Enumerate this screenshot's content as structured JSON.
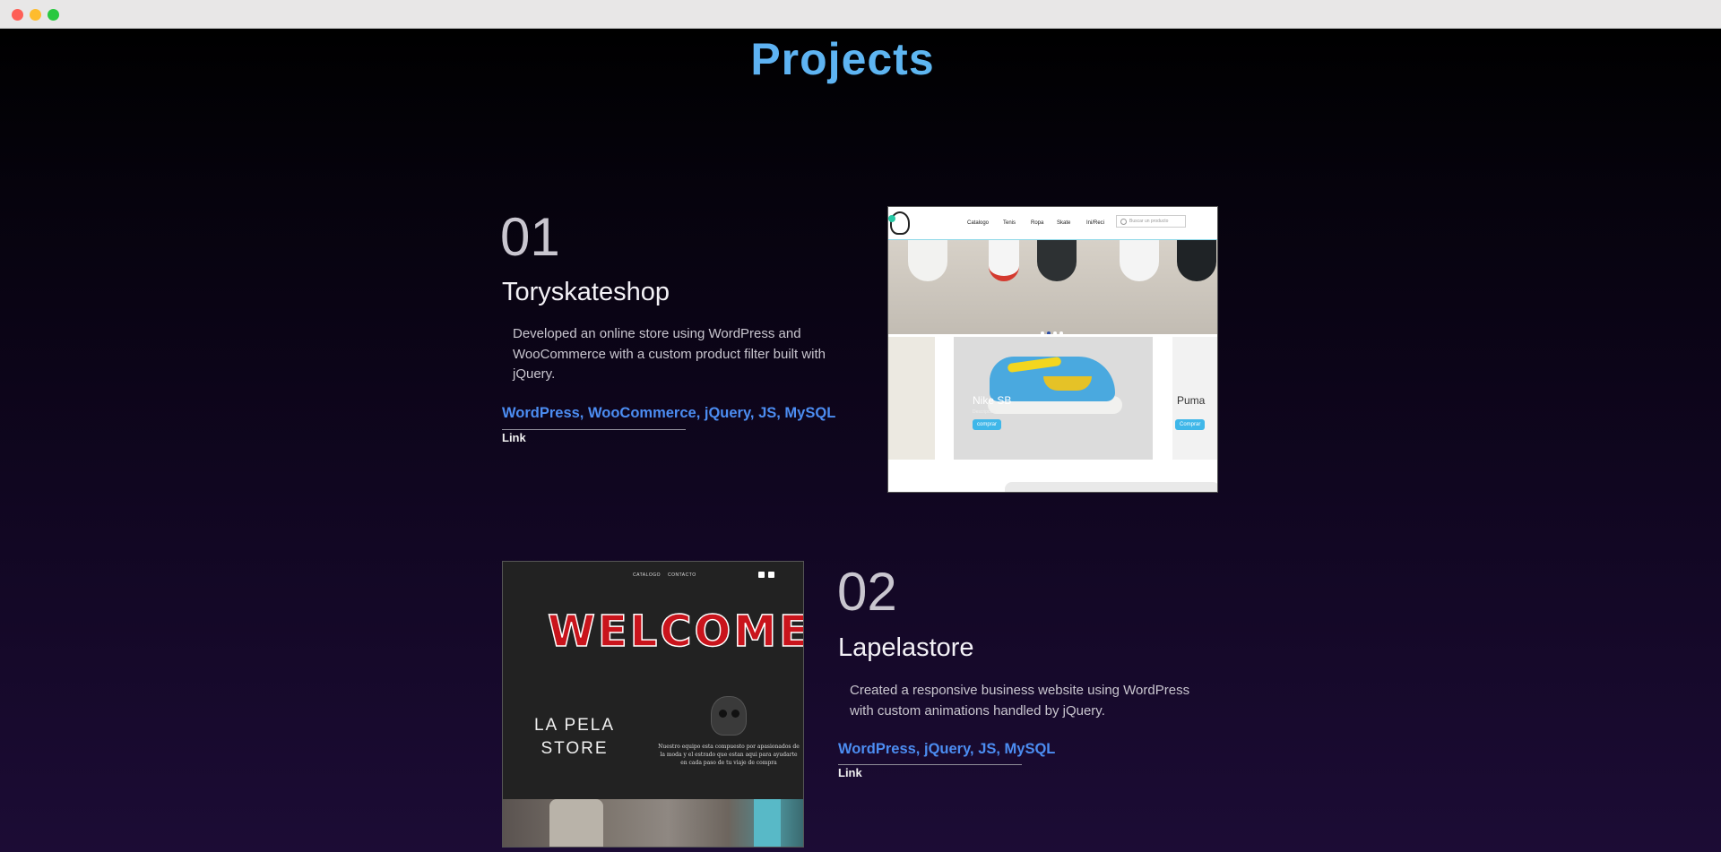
{
  "window": {
    "controls": [
      "close",
      "minimize",
      "maximize"
    ]
  },
  "section": {
    "title": "Projects"
  },
  "projects": [
    {
      "number": "01",
      "name": "Toryskateshop",
      "description": "Developed an online store using WordPress and WooCommerce with a custom product filter built with jQuery.",
      "tags": "WordPress, WooCommerce, jQuery, JS, MySQL",
      "link_label": "Link",
      "preview": {
        "nav": [
          "Catalogo",
          "Tenis",
          "Ropa",
          "Skate",
          "Ini/Reci"
        ],
        "search_placeholder": "Buscar un producto",
        "card_labels": [
          "Nike SB",
          "Puma"
        ],
        "buy_labels": [
          "comprar",
          "Comprar"
        ],
        "small_text": "Descripcion"
      }
    },
    {
      "number": "02",
      "name": "Lapelastore",
      "description": "Created a responsive business website using WordPress with custom animations handled by jQuery.",
      "tags": "WordPress, jQuery, JS, MySQL",
      "link_label": "Link",
      "preview": {
        "nav": [
          "CATALOGO",
          "CONTACTO"
        ],
        "welcome": "WELCOME",
        "store": "LA PELA STORE",
        "blurb": "Nuestro equipo esta compuesto por apasionados de la moda y el estrado que estan aqui para ayudarte en cada paso de tu viaje de compra"
      }
    }
  ],
  "colors": {
    "accent": "#4c8df2",
    "title_gradient_start": "#5aa2f5",
    "title_gradient_end": "#62c6ee",
    "background_bottom": "#1c0c35"
  }
}
